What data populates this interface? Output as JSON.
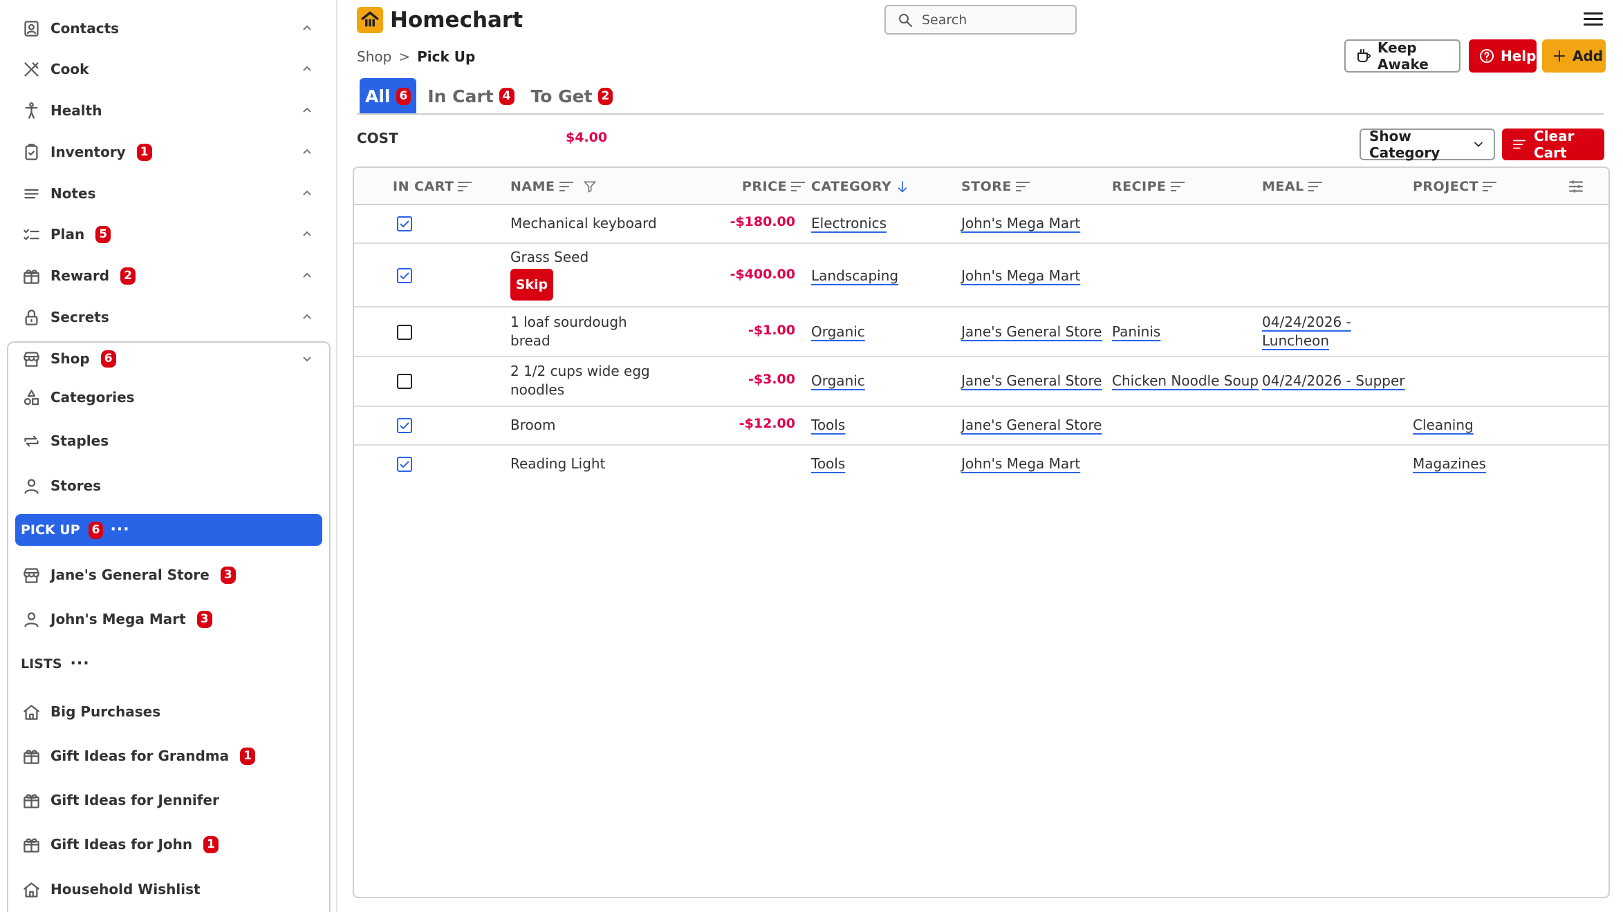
{
  "app": {
    "title": "Homechart"
  },
  "search": {
    "placeholder": "Search"
  },
  "sidebar": {
    "items": [
      {
        "label": "Contacts",
        "badge": ""
      },
      {
        "label": "Cook",
        "badge": ""
      },
      {
        "label": "Health",
        "badge": ""
      },
      {
        "label": "Inventory",
        "badge": "1"
      },
      {
        "label": "Notes",
        "badge": ""
      },
      {
        "label": "Plan",
        "badge": "5"
      },
      {
        "label": "Reward",
        "badge": "2"
      },
      {
        "label": "Secrets",
        "badge": ""
      }
    ],
    "shop": {
      "label": "Shop",
      "badge": "6",
      "sub": [
        "Categories",
        "Staples",
        "Stores"
      ],
      "pickup": {
        "label": "PICK UP",
        "badge": "6",
        "more": "···"
      },
      "stores": [
        {
          "label": "Jane's General Store",
          "badge": "3"
        },
        {
          "label": "John's Mega Mart",
          "badge": "3"
        }
      ],
      "lists_label": "LISTS",
      "lists_more": "···",
      "lists": [
        {
          "label": "Big Purchases",
          "badge": ""
        },
        {
          "label": "Gift Ideas for Grandma",
          "badge": "1"
        },
        {
          "label": "Gift Ideas for Jennifer",
          "badge": ""
        },
        {
          "label": "Gift Ideas for John",
          "badge": "1"
        },
        {
          "label": "Household Wishlist",
          "badge": ""
        }
      ]
    }
  },
  "breadcrumb": {
    "parent": "Shop",
    "sep": ">",
    "current": "Pick Up"
  },
  "header_buttons": {
    "keep_awake": "Keep Awake",
    "help": "Help",
    "add": "Add"
  },
  "tabs": [
    {
      "label": "All",
      "badge": "6",
      "active": true
    },
    {
      "label": "In Cart",
      "badge": "4",
      "active": false
    },
    {
      "label": "To Get",
      "badge": "2",
      "active": false
    }
  ],
  "cost": {
    "label": "COST",
    "value": "$4.00"
  },
  "controls": {
    "show_category": "Show Category",
    "clear_cart": "Clear Cart"
  },
  "table": {
    "columns": [
      "IN CART",
      "NAME",
      "PRICE",
      "CATEGORY",
      "STORE",
      "RECIPE",
      "MEAL",
      "PROJECT"
    ],
    "rows": [
      {
        "in_cart": true,
        "name_1": "Mechanical keyboard",
        "name_2": "",
        "skip": "",
        "price": "-$180.00",
        "category": "Electronics",
        "store": "John's Mega Mart",
        "recipe": "",
        "meal_1": "",
        "meal_2": "",
        "project": ""
      },
      {
        "in_cart": true,
        "name_1": "Grass Seed",
        "name_2": "",
        "skip": "Skip",
        "price": "-$400.00",
        "category": "Landscaping",
        "store": "John's Mega Mart",
        "recipe": "",
        "meal_1": "",
        "meal_2": "",
        "project": ""
      },
      {
        "in_cart": false,
        "name_1": "1 loaf sourdough",
        "name_2": "bread",
        "skip": "",
        "price": "-$1.00",
        "category": "Organic",
        "store": "Jane's General Store",
        "recipe": "Paninis",
        "meal_1": "04/24/2026 -",
        "meal_2": "Luncheon",
        "project": ""
      },
      {
        "in_cart": false,
        "name_1": "2 1/2 cups wide egg",
        "name_2": "noodles",
        "skip": "",
        "price": "-$3.00",
        "category": "Organic",
        "store": "Jane's General Store",
        "recipe": "Chicken Noodle Soup",
        "meal_1": "04/24/2026 - Supper",
        "meal_2": "",
        "project": ""
      },
      {
        "in_cart": true,
        "name_1": "Broom",
        "name_2": "",
        "skip": "",
        "price": "-$12.00",
        "category": "Tools",
        "store": "Jane's General Store",
        "recipe": "",
        "meal_1": "",
        "meal_2": "",
        "project": "Cleaning"
      },
      {
        "in_cart": true,
        "name_1": "Reading Light",
        "name_2": "",
        "skip": "",
        "price": "",
        "category": "Tools",
        "store": "John's Mega Mart",
        "recipe": "",
        "meal_1": "",
        "meal_2": "",
        "project": "Magazines"
      }
    ]
  },
  "colors": {
    "accent": "#2a64e6",
    "danger": "#d90012",
    "brand": "#f1a512",
    "price": "#e0004d"
  }
}
